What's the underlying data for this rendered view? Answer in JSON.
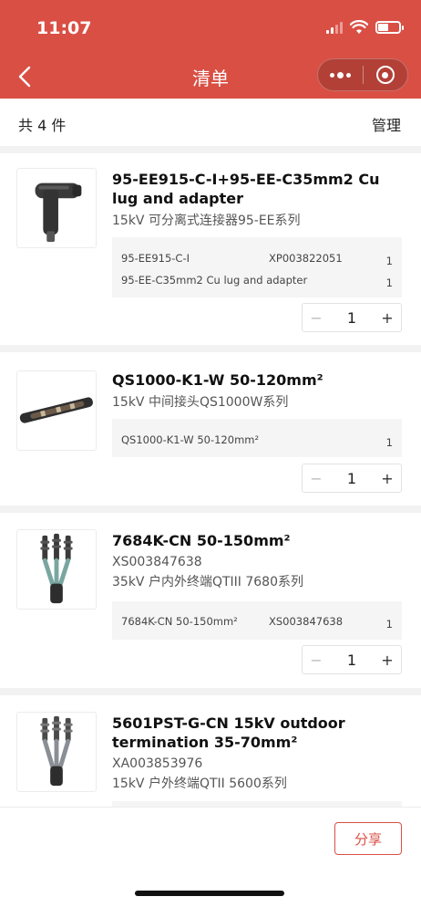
{
  "status_bar": {
    "time": "11:07"
  },
  "nav": {
    "title": "清单"
  },
  "summary": {
    "count_label": "共 4 件",
    "manage_label": "管理"
  },
  "products": [
    {
      "name": "95-EE915-C-I+95-EE-C35mm2 Cu lug and adapter",
      "code": "",
      "subtitle": "15kV 可分离式连接器95-EE系列",
      "image": "elbow-connector-image",
      "details": [
        {
          "model": "95-EE915-C-I",
          "sku": "XP003822051",
          "qty": "1"
        },
        {
          "model": "95-EE-C35mm2 Cu lug and adapter",
          "sku": "",
          "qty": "1"
        }
      ],
      "quantity": "1"
    },
    {
      "name": "QS1000-K1-W 50-120mm²",
      "code": "",
      "subtitle": "15kV 中间接头QS1000W系列",
      "image": "splice-joint-image",
      "details": [
        {
          "model": "QS1000-K1-W 50-120mm²",
          "sku": "",
          "qty": "1"
        }
      ],
      "quantity": "1"
    },
    {
      "name": "7684K-CN 50-150mm²",
      "code": "XS003847638",
      "subtitle": "35kV 户内外终端QTIII 7680系列",
      "image": "termination-kit-image",
      "details": [
        {
          "model": "7684K-CN 50-150mm²",
          "sku": "XS003847638",
          "qty": "1"
        }
      ],
      "quantity": "1"
    },
    {
      "name": "5601PST-G-CN 15kV outdoor termination 35-70mm²",
      "code": "XA003853976",
      "subtitle": "15kV 户外终端QTII 5600系列",
      "image": "outdoor-termination-image",
      "details": [],
      "quantity": ""
    }
  ],
  "footer": {
    "share_label": "分享"
  },
  "colors": {
    "brand": "#d94f44",
    "background": "#f2f2f2"
  }
}
